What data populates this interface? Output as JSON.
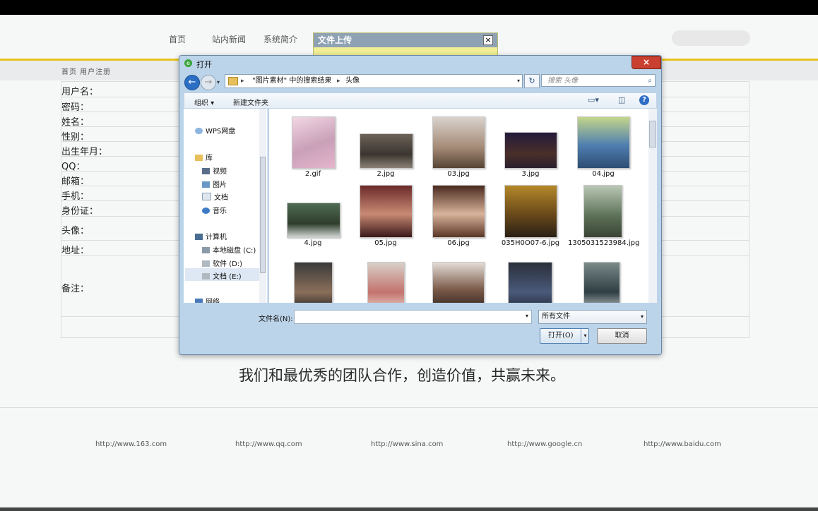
{
  "nav": {
    "items": [
      "首页",
      "站内新闻",
      "系统简介"
    ]
  },
  "breadcrumb": "首页 用户注册",
  "form": {
    "labels": [
      "用户名：",
      "密码：",
      "姓名：",
      "性别：",
      "出生年月：",
      "QQ：",
      "邮箱：",
      "手机：",
      "身份证：",
      "头像：",
      "地址：",
      "备注："
    ]
  },
  "upload_panel": {
    "title": "文件上传",
    "close": "×"
  },
  "dialog": {
    "title": "打开",
    "close": "×",
    "back": "←",
    "forward": "→",
    "address": {
      "part1": "\"图片素材\" 中的搜索结果",
      "part2": "头像"
    },
    "search_placeholder": "搜索 头像",
    "toolbar": {
      "organize": "组织 ▾",
      "new_folder": "新建文件夹",
      "help": "?"
    },
    "nav_tree": {
      "wps": "WPS网盘",
      "library": "库",
      "videos": "视频",
      "pictures": "图片",
      "documents": "文档",
      "music": "音乐",
      "computer": "计算机",
      "drive_c": "本地磁盘 (C:)",
      "drive_d": "软件 (D:)",
      "drive_e": "文档 (E:)",
      "network": "网络"
    },
    "files": [
      {
        "name": "2.gif"
      },
      {
        "name": "2.jpg"
      },
      {
        "name": "03.jpg"
      },
      {
        "name": "3.jpg"
      },
      {
        "name": "04.jpg"
      },
      {
        "name": "4.jpg"
      },
      {
        "name": "05.jpg"
      },
      {
        "name": "06.jpg"
      },
      {
        "name": "035H0O07-6.jpg"
      },
      {
        "name": "1305031523984.jpg"
      },
      {
        "name": ""
      },
      {
        "name": ""
      },
      {
        "name": ""
      },
      {
        "name": ""
      },
      {
        "name": ""
      }
    ],
    "filename_label": "文件名(N):",
    "filename_value": "",
    "filetype": "所有文件",
    "open_button": "打开(O)",
    "cancel_button": "取消"
  },
  "slogan": "我们和最优秀的团队合作，创造价值，共赢未来。",
  "footer_links": [
    "http://www.163.com",
    "http://www.qq.com",
    "http://www.sina.com",
    "http://www.google.cn",
    "http://www.baidu.com"
  ],
  "colors": {
    "accent_yellow": "#e8c21c",
    "dialog_frame": "#bcd4ea",
    "close_red": "#c94030"
  }
}
